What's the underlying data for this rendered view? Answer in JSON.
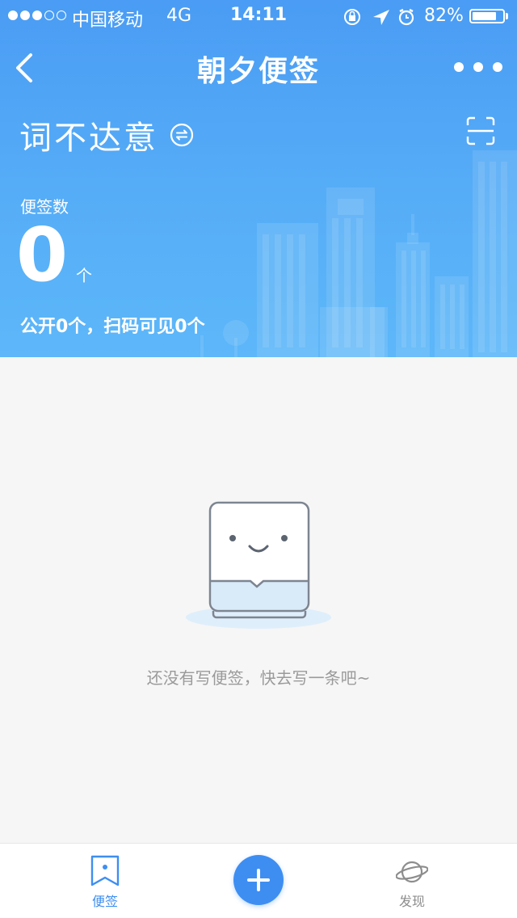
{
  "status_bar": {
    "carrier": "中国移动",
    "network": "4G",
    "time": "14:11",
    "battery_percent": "82%",
    "battery_level": 0.82,
    "signal_bars_filled": 3,
    "signal_bars_total": 5
  },
  "nav": {
    "title": "朝夕便签",
    "back_icon": "chevron-left-icon",
    "more_icon": "more-dots-icon"
  },
  "user": {
    "name": "词不达意",
    "switch_icon": "switch-account-icon",
    "scan_icon": "scan-icon"
  },
  "stats": {
    "label": "便签数",
    "count": "0",
    "unit": "个",
    "summary": "公开0个，扫码可见0个"
  },
  "empty_state": {
    "message": "还没有写便签，快去写一条吧~",
    "illustration": "smiling-note-icon"
  },
  "tab_bar": {
    "notes_label": "便签",
    "discover_label": "发现",
    "add_icon": "plus-icon",
    "active_tab": "便签"
  },
  "colors": {
    "header_blue": "#4a9cf4",
    "accent": "#3e8ef2",
    "background": "#f6f6f6",
    "muted_text": "#9a9a9a"
  }
}
